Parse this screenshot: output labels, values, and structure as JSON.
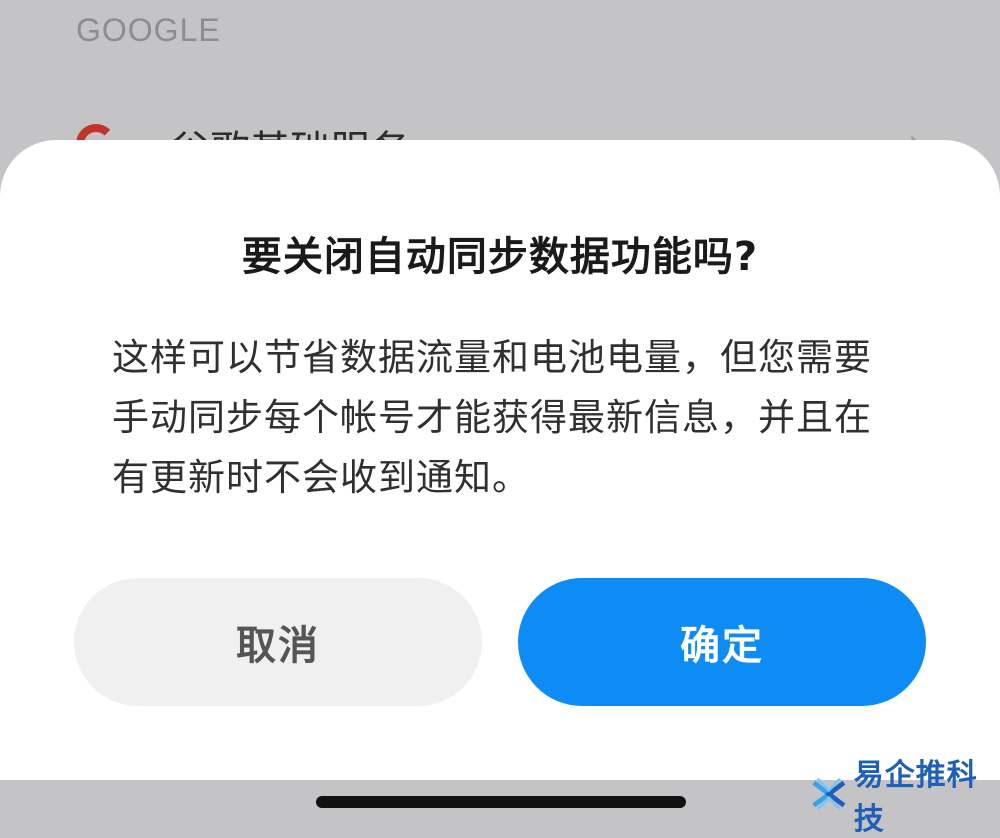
{
  "background": {
    "section_header": "GOOGLE",
    "list_item_label": "谷歌基础服务",
    "list_item_icon": "google-g-icon",
    "chevron_icon": "chevron-right-icon"
  },
  "dialog": {
    "title": "要关闭自动同步数据功能吗?",
    "message": "这样可以节省数据流量和电池电量，但您需要手动同步每个帐号才能获得最新信息，并且在有更新时不会收到通知。",
    "cancel_label": "取消",
    "ok_label": "确定"
  },
  "watermark": {
    "text": "易企推科技",
    "logo_icon": "watermark-logo-icon"
  },
  "colors": {
    "accent": "#0d8cf5",
    "cancel_bg": "#f0f0f0",
    "dim_background": "#c4c4c6"
  }
}
